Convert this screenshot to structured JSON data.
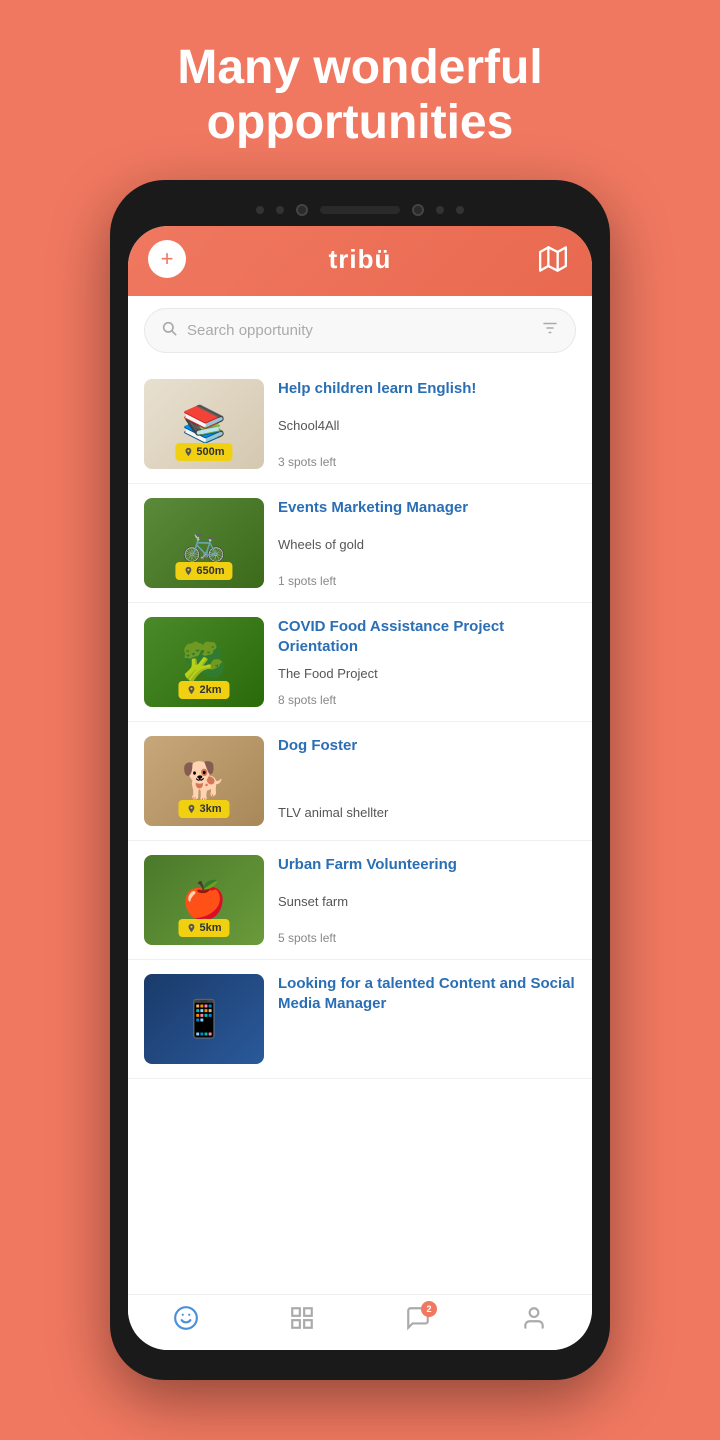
{
  "page": {
    "background_color": "#F07860",
    "title_line1": "Many wonderful",
    "title_line2": "opportunities"
  },
  "header": {
    "add_label": "+",
    "logo_text": "tribü",
    "app_name": "tribu"
  },
  "search": {
    "placeholder": "Search opportunity"
  },
  "opportunities": [
    {
      "id": 1,
      "title": "Help children learn English!",
      "organization": "School4All",
      "distance": "500m",
      "spots_left": "3 spots left",
      "image_class": "img-english"
    },
    {
      "id": 2,
      "title": "Events Marketing Manager",
      "organization": "Wheels of gold",
      "distance": "650m",
      "spots_left": "1 spots left",
      "image_class": "img-marketing"
    },
    {
      "id": 3,
      "title": "COVID Food Assistance Project Orientation",
      "organization": "The Food Project",
      "distance": "2km",
      "spots_left": "8 spots left",
      "image_class": "img-food"
    },
    {
      "id": 4,
      "title": "Dog Foster",
      "organization": "TLV animal shellter",
      "distance": "3km",
      "spots_left": "",
      "image_class": "img-dog"
    },
    {
      "id": 5,
      "title": "Urban Farm Volunteering",
      "organization": "Sunset farm",
      "distance": "5km",
      "spots_left": "5 spots left",
      "image_class": "img-farm"
    },
    {
      "id": 6,
      "title": "Looking for a talented Content and Social Media Manager",
      "organization": "",
      "distance": "",
      "spots_left": "",
      "image_class": "img-social"
    }
  ],
  "bottom_nav": {
    "items": [
      {
        "icon": "smile",
        "label": "Home",
        "active": true
      },
      {
        "icon": "list",
        "label": "Feed",
        "active": false
      },
      {
        "icon": "chat",
        "label": "Chat",
        "active": false,
        "badge": "2"
      },
      {
        "icon": "person",
        "label": "Profile",
        "active": false
      }
    ]
  },
  "icons": {
    "search": "🔍",
    "filter": "⊻",
    "pin": "📍",
    "plus": "+",
    "smile": "☺",
    "list": "☰",
    "chat": "💬",
    "person": "👤"
  }
}
